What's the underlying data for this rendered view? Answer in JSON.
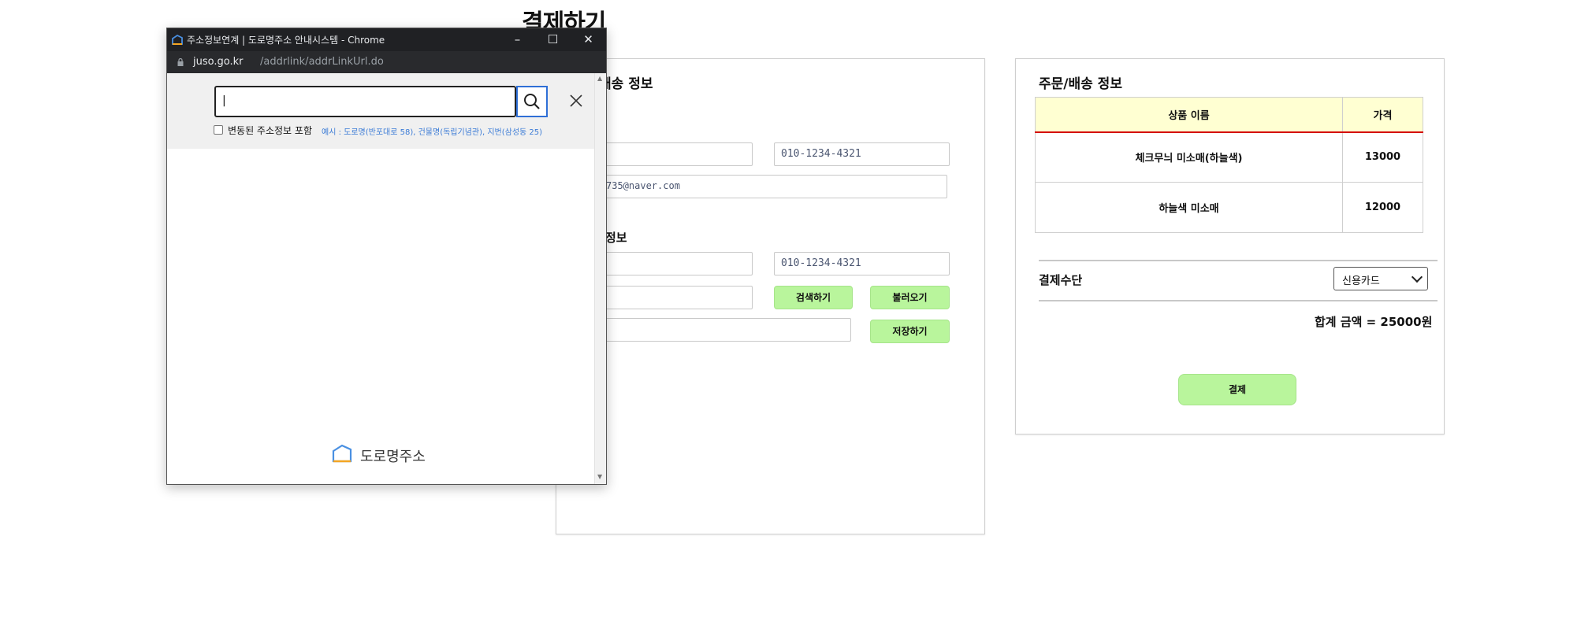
{
  "page": {
    "title": "결제하기"
  },
  "left": {
    "orderer_title": "배송 정보",
    "orderer_phone": "010-1234-4321",
    "orderer_email": "735@naver.com",
    "delivery_title": "정보",
    "delivery_phone": "010-1234-4321",
    "search_label": "검색하기",
    "load_label": "불러오기",
    "save_label": "저장하기"
  },
  "right": {
    "title": "주문/배송 정보",
    "table": {
      "headers": [
        "상품 이름",
        "가격"
      ],
      "rows": [
        {
          "name": "체크무늬 미소매(하늘색)",
          "price": "13000"
        },
        {
          "name": "하늘색 미소매",
          "price": "12000"
        }
      ]
    },
    "payment_label": "결제수단",
    "payment_value": "신용카드",
    "total": "합계 금액 = 25000원",
    "pay_button": "결제"
  },
  "popup": {
    "window_title": "주소정보연계 | 도로명주소 안내시스템 - Chrome",
    "url_domain": "juso.go.kr",
    "url_path": "/addrlink/addrLinkUrl.do",
    "search_value": "|",
    "checkbox_label": "변동된 주소정보 포함",
    "example_text": "예시 : 도로명(반포대로 58), 건물명(독립기념관), 지번(삼성동 25)",
    "logo_text": "도로명주소"
  },
  "colors": {
    "accent_green": "#b9f59c",
    "table_header_bg": "#ffffd2",
    "table_header_line": "#d40000",
    "link_blue": "#3b7bd6"
  }
}
